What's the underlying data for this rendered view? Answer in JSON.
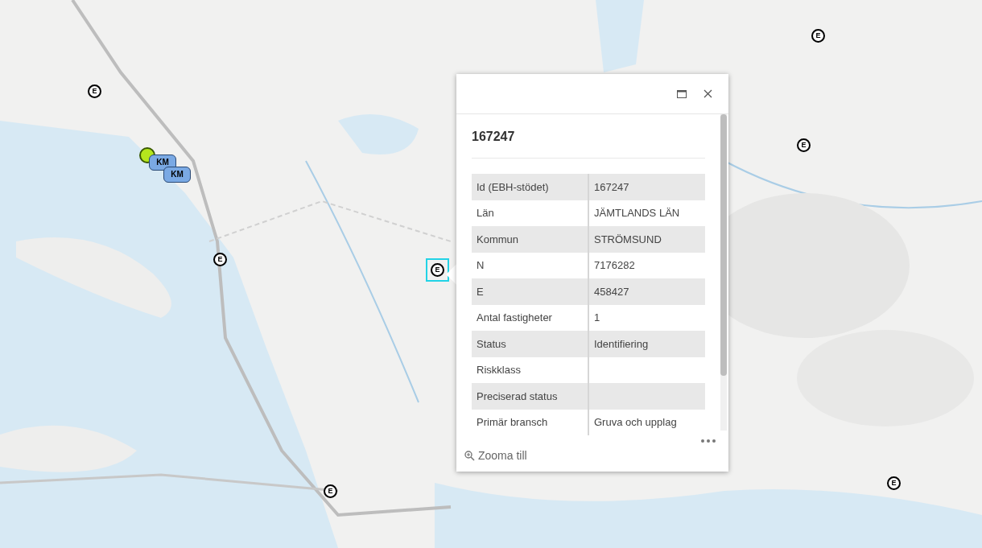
{
  "markers": [
    {
      "kind": "e",
      "label": "E",
      "selected": false
    },
    {
      "kind": "e",
      "label": "E",
      "selected": false
    },
    {
      "kind": "e",
      "label": "E",
      "selected": false
    },
    {
      "kind": "e",
      "label": "E",
      "selected": false
    },
    {
      "kind": "e",
      "label": "E",
      "selected": true
    },
    {
      "kind": "e",
      "label": "E",
      "selected": false
    },
    {
      "kind": "e",
      "label": "E",
      "selected": false
    },
    {
      "kind": "dot",
      "selected": false
    },
    {
      "kind": "km",
      "label": "KM",
      "selected": false
    },
    {
      "kind": "km",
      "label": "KM",
      "selected": false
    }
  ],
  "popup": {
    "title": "167247",
    "rows": [
      {
        "label": "Id (EBH-stödet)",
        "value": "167247"
      },
      {
        "label": "Län",
        "value": "JÄMTLANDS LÄN"
      },
      {
        "label": "Kommun",
        "value": "STRÖMSUND"
      },
      {
        "label": "N",
        "value": "7176282"
      },
      {
        "label": "E",
        "value": "458427"
      },
      {
        "label": "Antal fastigheter",
        "value": "1"
      },
      {
        "label": "Status",
        "value": "Identifiering"
      },
      {
        "label": "Riskklass"
      },
      {
        "label": "Preciserad status"
      },
      {
        "label": "Primär bransch",
        "value": "Gruva och upplag"
      }
    ],
    "action": "Zooma till"
  }
}
